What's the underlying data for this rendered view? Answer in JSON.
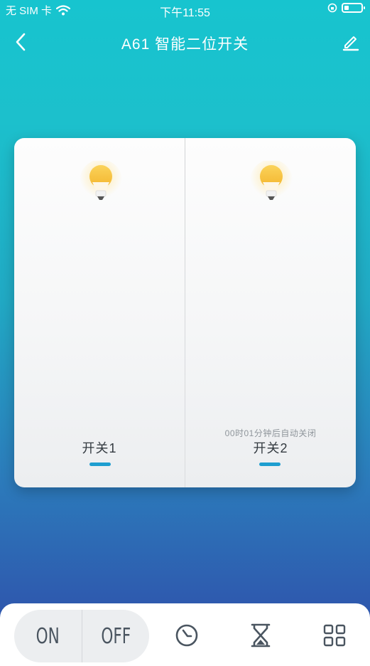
{
  "status_bar": {
    "carrier": "无 SIM 卡",
    "time": "下午11:55"
  },
  "nav": {
    "title": "A61 智能二位开关",
    "back_icon": "chevron-left-icon",
    "edit_icon": "pencil-icon"
  },
  "switches": [
    {
      "label": "开关1",
      "state": "on",
      "timer": ""
    },
    {
      "label": "开关2",
      "state": "on",
      "timer": "00时01分钟后自动关闭"
    }
  ],
  "bottom_bar": {
    "on_label": "ON",
    "off_label": "OFF",
    "icons": [
      "clock-icon",
      "hourglass-icon",
      "grid-icon"
    ]
  },
  "colors": {
    "accent": "#1e9ed0",
    "bulb": "#f7c443",
    "gradient_top": "#17c4cf",
    "gradient_bottom": "#2f49a8"
  }
}
